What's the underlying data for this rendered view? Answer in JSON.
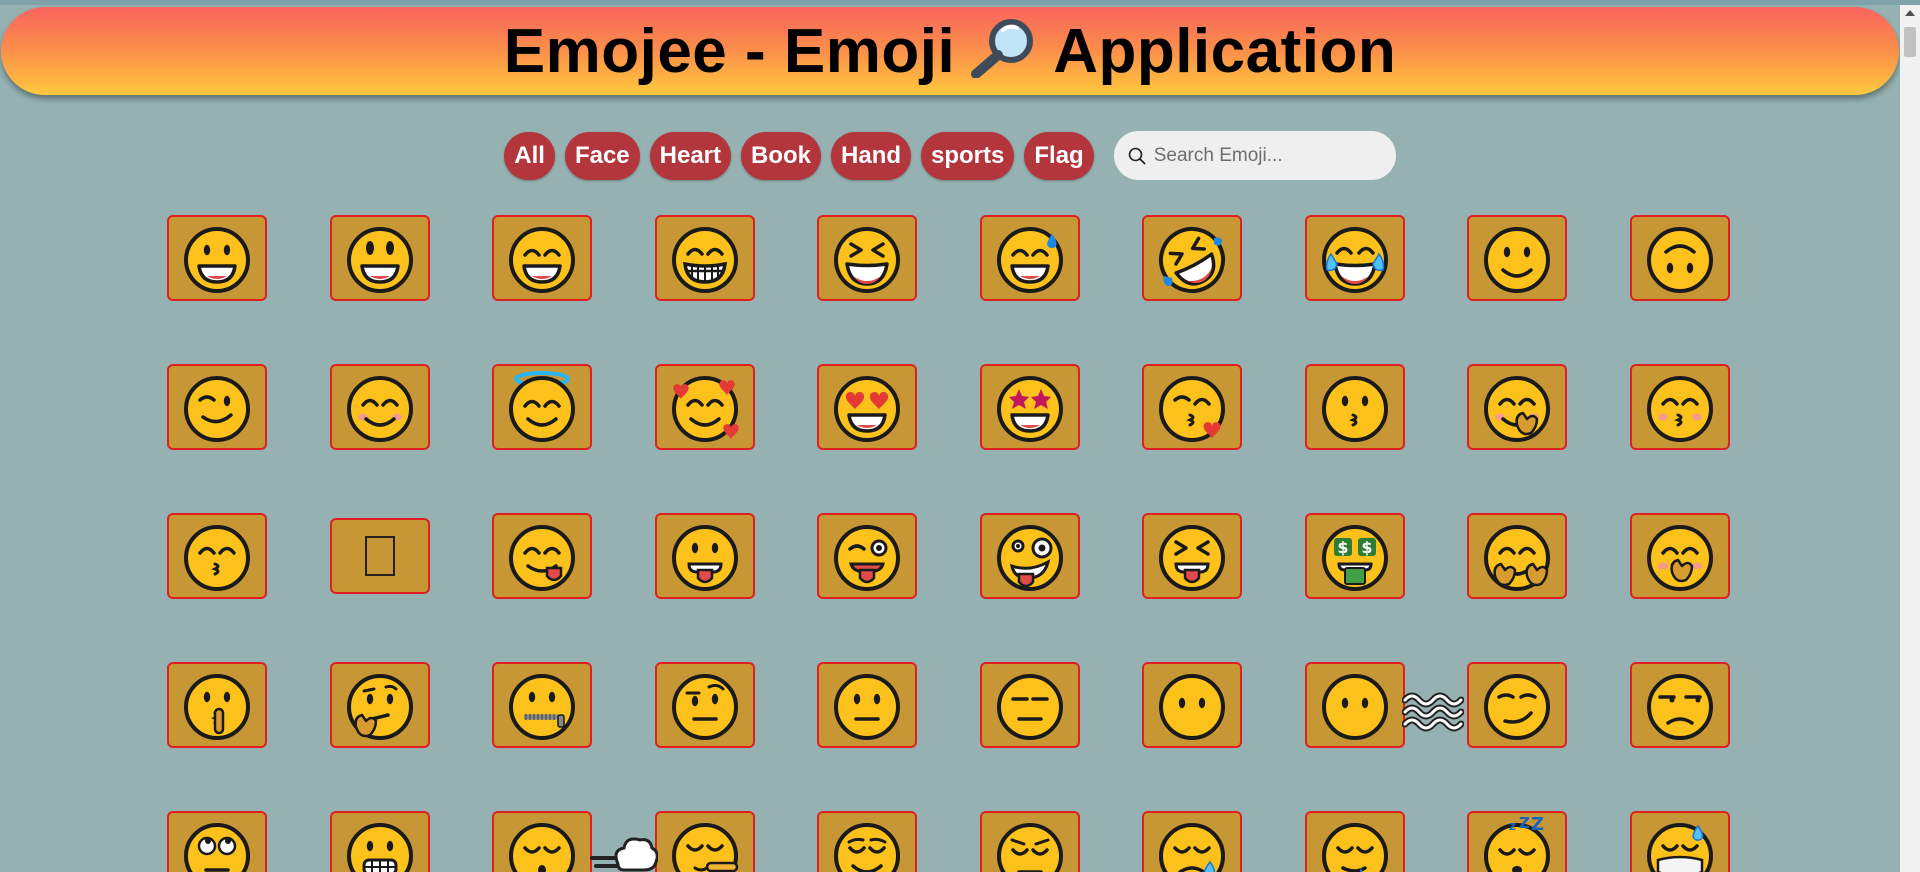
{
  "header": {
    "title_left": "Emojee - Emoji",
    "title_right": "Application",
    "title_icon": "magnifying-glass-icon"
  },
  "filters": [
    {
      "label": "All"
    },
    {
      "label": "Face"
    },
    {
      "label": "Heart"
    },
    {
      "label": "Book"
    },
    {
      "label": "Hand"
    },
    {
      "label": "sports"
    },
    {
      "label": "Flag"
    }
  ],
  "search": {
    "placeholder": "Search Emoji...",
    "value": ""
  },
  "colors": {
    "background": "#95b1b1",
    "chip": "#b3363c",
    "card": "#c89735",
    "card_border": "#e02020",
    "face": "#fcc21b"
  },
  "emojis": [
    "grinning-face",
    "grinning-face-big-eyes",
    "grinning-face-smiling-eyes",
    "beaming-face",
    "grinning-squinting-face",
    "grinning-face-sweat",
    "rolling-on-floor-laughing",
    "face-tears-of-joy",
    "slightly-smiling-face",
    "upside-down-face",
    "winking-face",
    "smiling-face-smiling-eyes",
    "smiling-face-halo",
    "smiling-face-hearts",
    "heart-eyes",
    "star-struck",
    "face-blowing-kiss",
    "kissing-face",
    "smiling-face-open-hands",
    "kissing-face-closed-eyes",
    "kissing-face-smiling-eyes",
    "missing-glyph",
    "face-savoring-food",
    "face-with-tongue",
    "winking-face-tongue",
    "zany-face",
    "squinting-face-tongue",
    "money-mouth-face",
    "hugging-face",
    "face-hand-over-mouth",
    "shushing-face",
    "thinking-face",
    "zipper-mouth-face",
    "raised-eyebrow-face",
    "neutral-face",
    "expressionless-face",
    "face-without-mouth",
    "face-in-clouds",
    "smirking-face",
    "unamused-face",
    "face-rolling-eyes",
    "grimacing-face",
    "face-exhaling",
    "lying-face",
    "relieved-face",
    "pensive-face",
    "sleepy-face",
    "drooling-face",
    "sleeping-face",
    "face-medical-mask"
  ]
}
